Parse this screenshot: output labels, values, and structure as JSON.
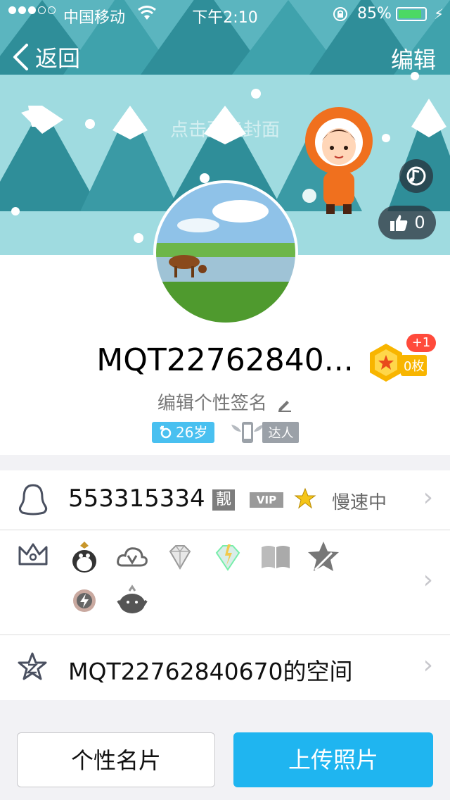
{
  "status_bar": {
    "carrier": "中国移动",
    "time": "下午2:10",
    "battery": "85%",
    "battery_level": 0.85
  },
  "nav": {
    "back_label": "返回",
    "edit_label": "编辑"
  },
  "cover": {
    "hint": "点击更换封面",
    "like_count": "0"
  },
  "profile": {
    "nickname": "MQT22762840...",
    "medal_plus": "+1",
    "medal_count": "0枚",
    "signature": "编辑个性签名",
    "age_tag": "26岁",
    "daren_tag": "达人"
  },
  "rows": {
    "qq_number": "553315334",
    "liang_badge": "靓",
    "vip_badge": "VIP",
    "speed_status": "慢速中",
    "privilege_icons": [
      "penguin-icon",
      "weiyun-icon",
      "diamond-icon",
      "super-diamond-icon",
      "book-icon",
      "star-icon",
      "sound-icon",
      "bird-icon"
    ],
    "zone_label": "MQT22762840670的空间"
  },
  "buttons": {
    "card_label": "个性名片",
    "upload_label": "上传照片"
  },
  "colors": {
    "accent": "#1fb5f0",
    "cover_bg": "#9fdbe0",
    "tree_dark": "#2f8e99",
    "badge_red": "#ff4a3b",
    "battery_green": "#4cd964"
  }
}
